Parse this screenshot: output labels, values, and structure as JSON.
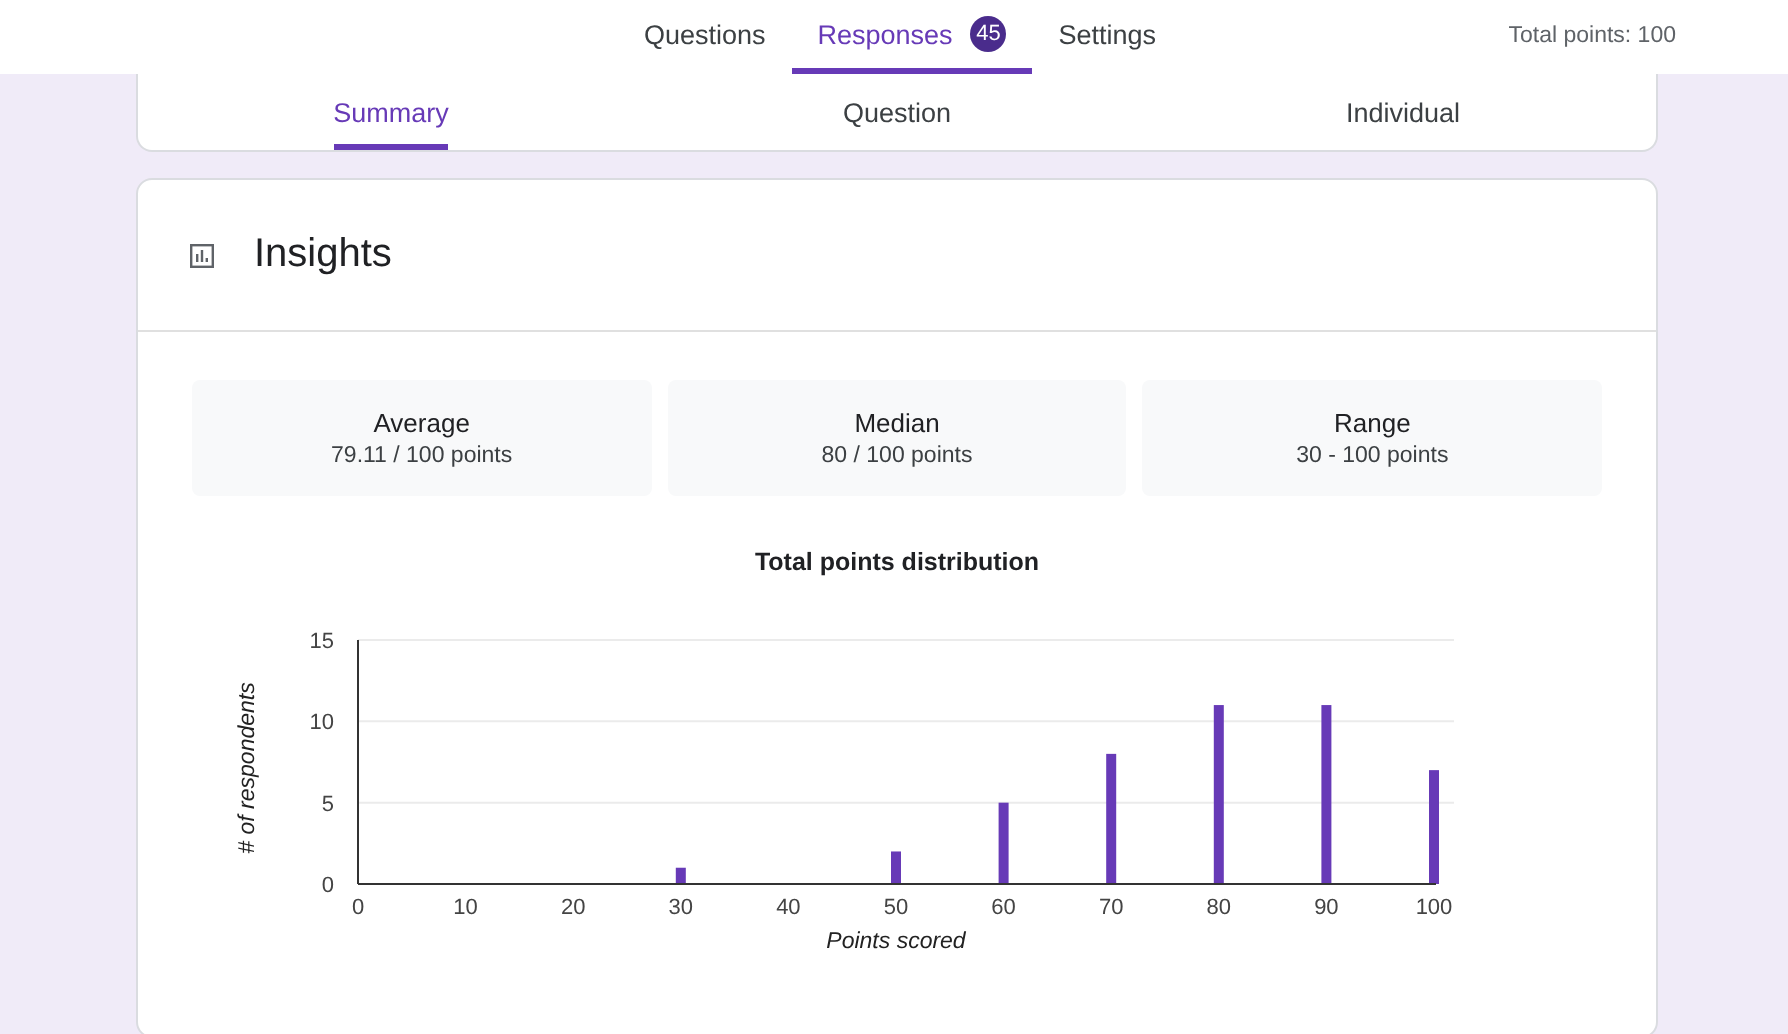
{
  "top_tabs": [
    {
      "label": "Questions",
      "selected": false
    },
    {
      "label": "Responses",
      "selected": true,
      "badge": "45"
    },
    {
      "label": "Settings",
      "selected": false
    }
  ],
  "total_points": "Total points: 100",
  "view_tabs": [
    {
      "label": "Summary",
      "selected": true
    },
    {
      "label": "Question",
      "selected": false
    },
    {
      "label": "Individual",
      "selected": false
    }
  ],
  "insights": {
    "title": "Insights",
    "stats": [
      {
        "label": "Average",
        "value": "79.11 / 100 points"
      },
      {
        "label": "Median",
        "value": "80 / 100 points"
      },
      {
        "label": "Range",
        "value": "30 - 100 points"
      }
    ],
    "chart_data": {
      "type": "bar",
      "title": "Total points distribution",
      "xlabel": "Points scored",
      "ylabel": "# of respondents",
      "x": [
        30,
        50,
        60,
        70,
        80,
        90,
        100
      ],
      "series": [
        {
          "color": "#673ab7",
          "values": [
            1,
            2,
            5,
            8,
            11,
            11,
            7
          ]
        }
      ],
      "xlim": [
        0,
        100
      ],
      "ylim": [
        0,
        15
      ],
      "xticks": [
        0,
        10,
        20,
        30,
        40,
        50,
        60,
        70,
        80,
        90,
        100
      ],
      "yticks": [
        0,
        5,
        10,
        15
      ]
    }
  }
}
